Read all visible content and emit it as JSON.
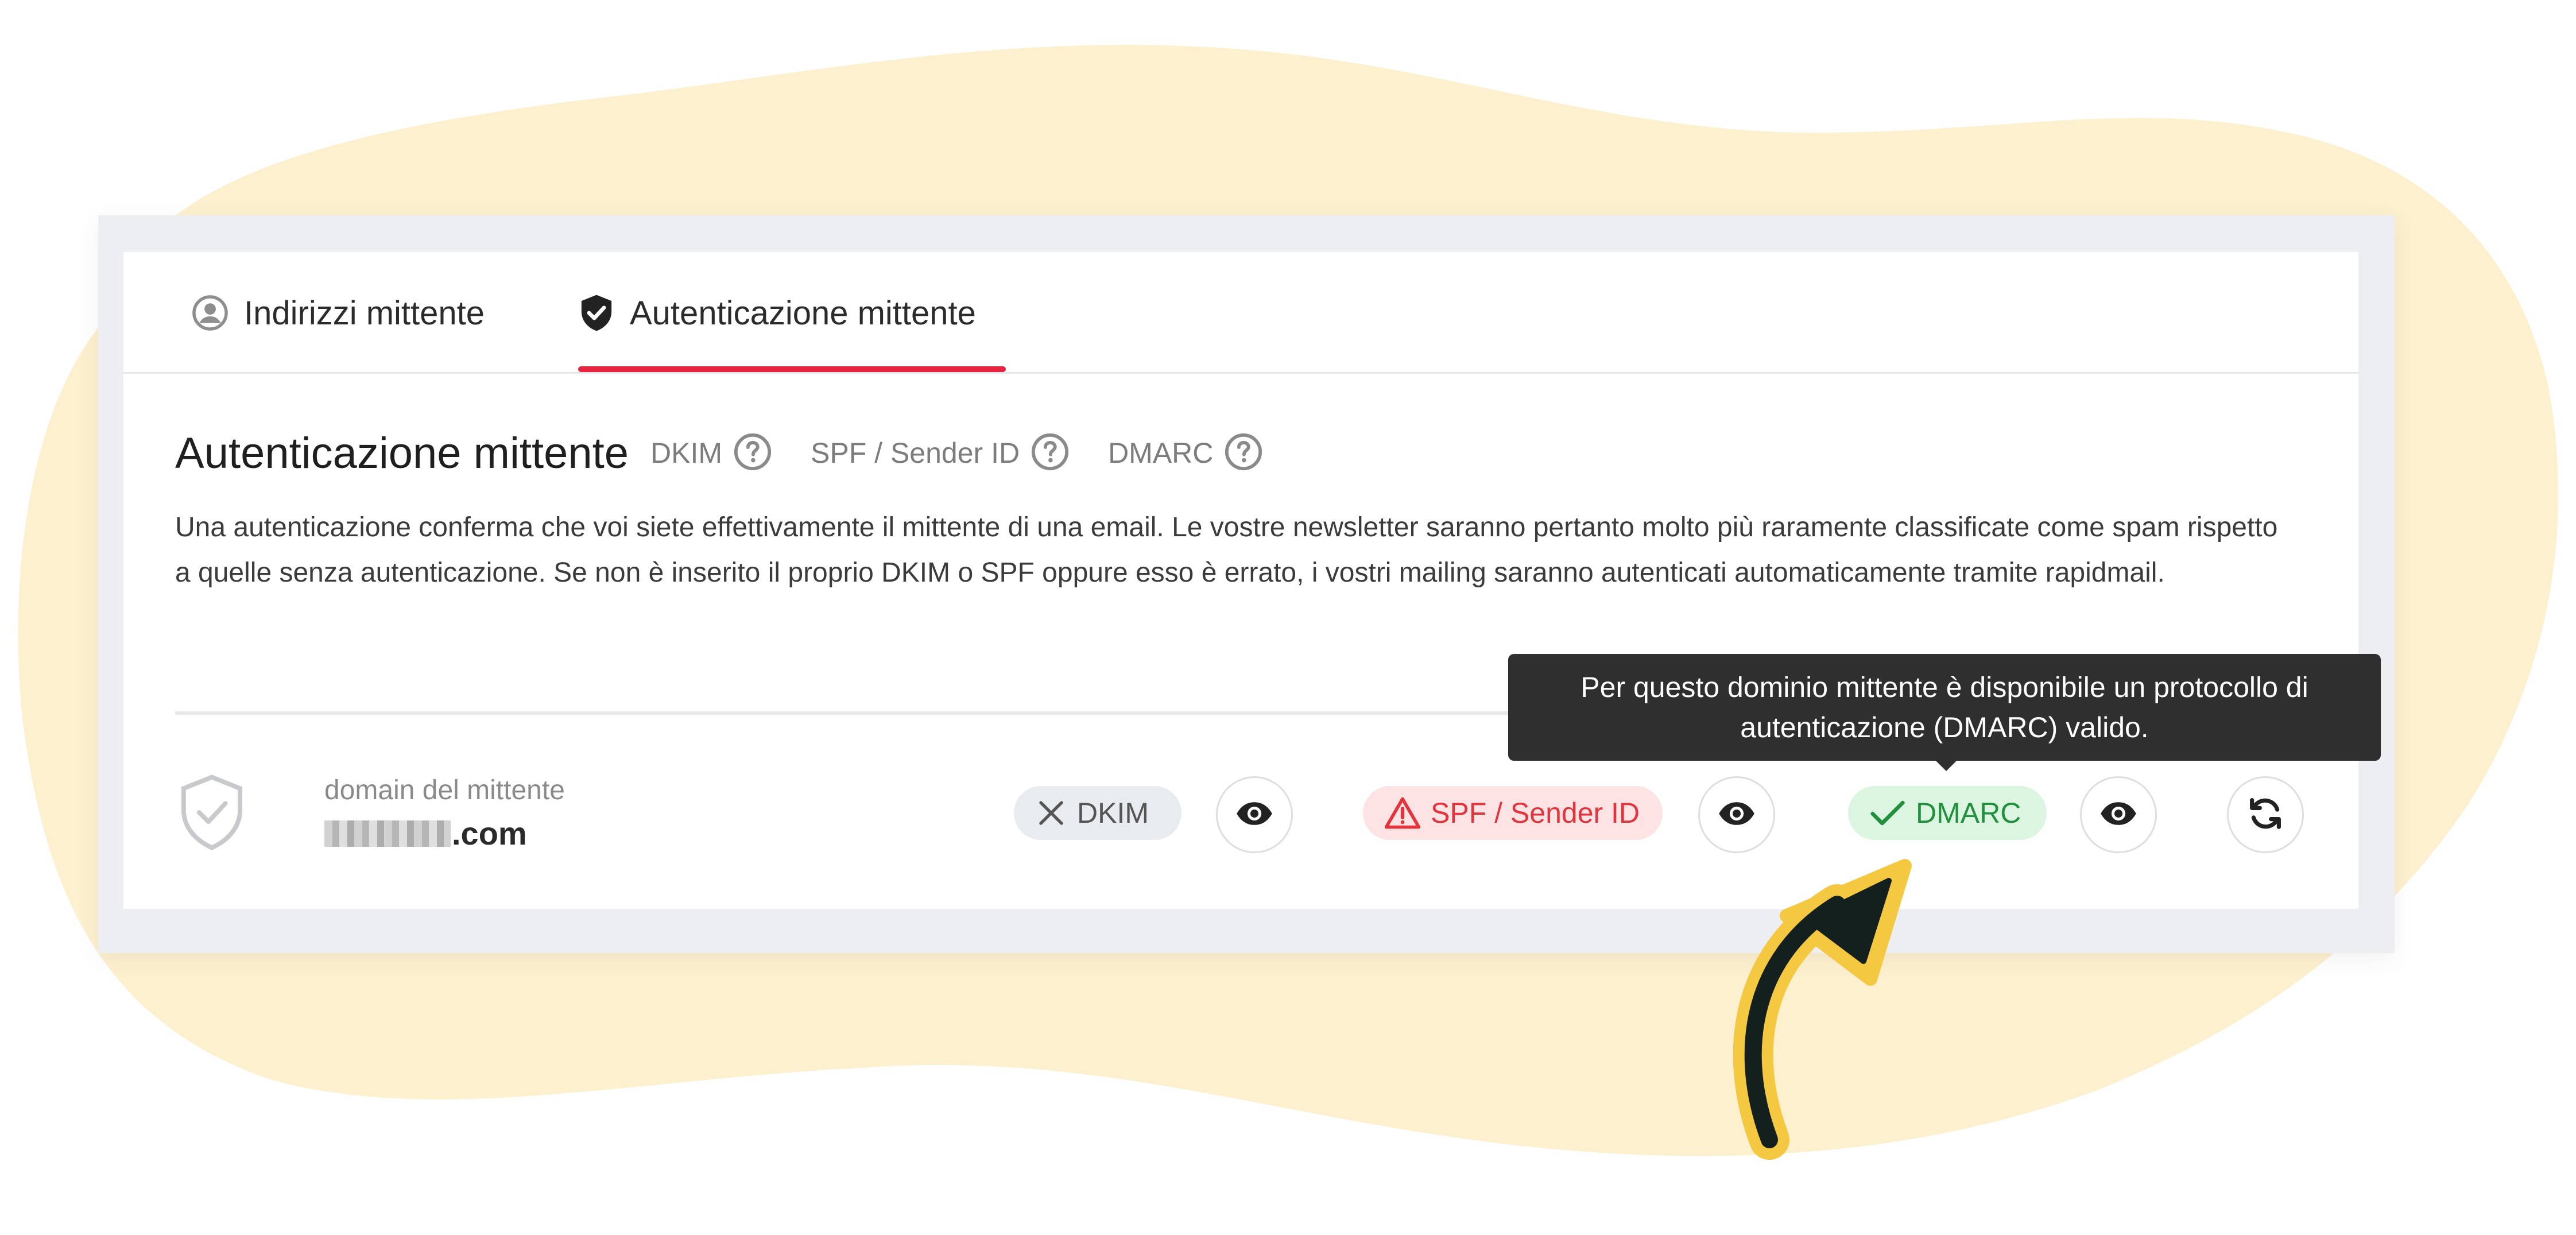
{
  "colors": {
    "background_blob": "#fdf0cf",
    "accent_red": "#e8233f",
    "dkim_badge_bg": "#e8ebef",
    "spf_badge_bg": "#fde3e3",
    "spf_badge_text": "#e2343c",
    "dmarc_badge_bg": "#dcf5e1",
    "dmarc_badge_text": "#21903d",
    "tooltip_bg": "#2f2f2f",
    "arrow_fill": "#f5c842"
  },
  "tabs": [
    {
      "label": "Indirizzi mittente",
      "icon": "user-circle-icon",
      "active": false
    },
    {
      "label": "Autenticazione mittente",
      "icon": "shield-check-icon",
      "active": true
    }
  ],
  "section": {
    "title": "Autenticazione mittente",
    "help_links": [
      {
        "label": "DKIM",
        "icon": "question-circle-icon"
      },
      {
        "label": "SPF / Sender ID",
        "icon": "question-circle-icon"
      },
      {
        "label": "DMARC",
        "icon": "question-circle-icon"
      }
    ],
    "description": "Una autenticazione conferma che voi siete effettivamente il mittente di una email. Le vostre newsletter saranno pertanto molto più raramente classificate come spam rispetto a quelle senza autenticazione. Se non è inserito il proprio DKIM o SPF oppure esso è errato, i vostri mailing saranno autenticati automaticamente tramite rapidmail."
  },
  "domain_row": {
    "label": "domain del mittente",
    "value_suffix": ".com",
    "status_icon": "shield-check-outline-icon",
    "badges": [
      {
        "label": "DKIM",
        "status": "missing",
        "icon": "x-icon"
      },
      {
        "label": "SPF / Sender ID",
        "status": "error",
        "icon": "warning-triangle-icon"
      },
      {
        "label": "DMARC",
        "status": "valid",
        "icon": "checkmark-icon"
      }
    ],
    "view_icon": "eye-icon",
    "refresh_icon": "refresh-icon"
  },
  "tooltip": {
    "text": "Per questo dominio mittente è disponibile un protocollo di autenticazione (DMARC) valido."
  }
}
